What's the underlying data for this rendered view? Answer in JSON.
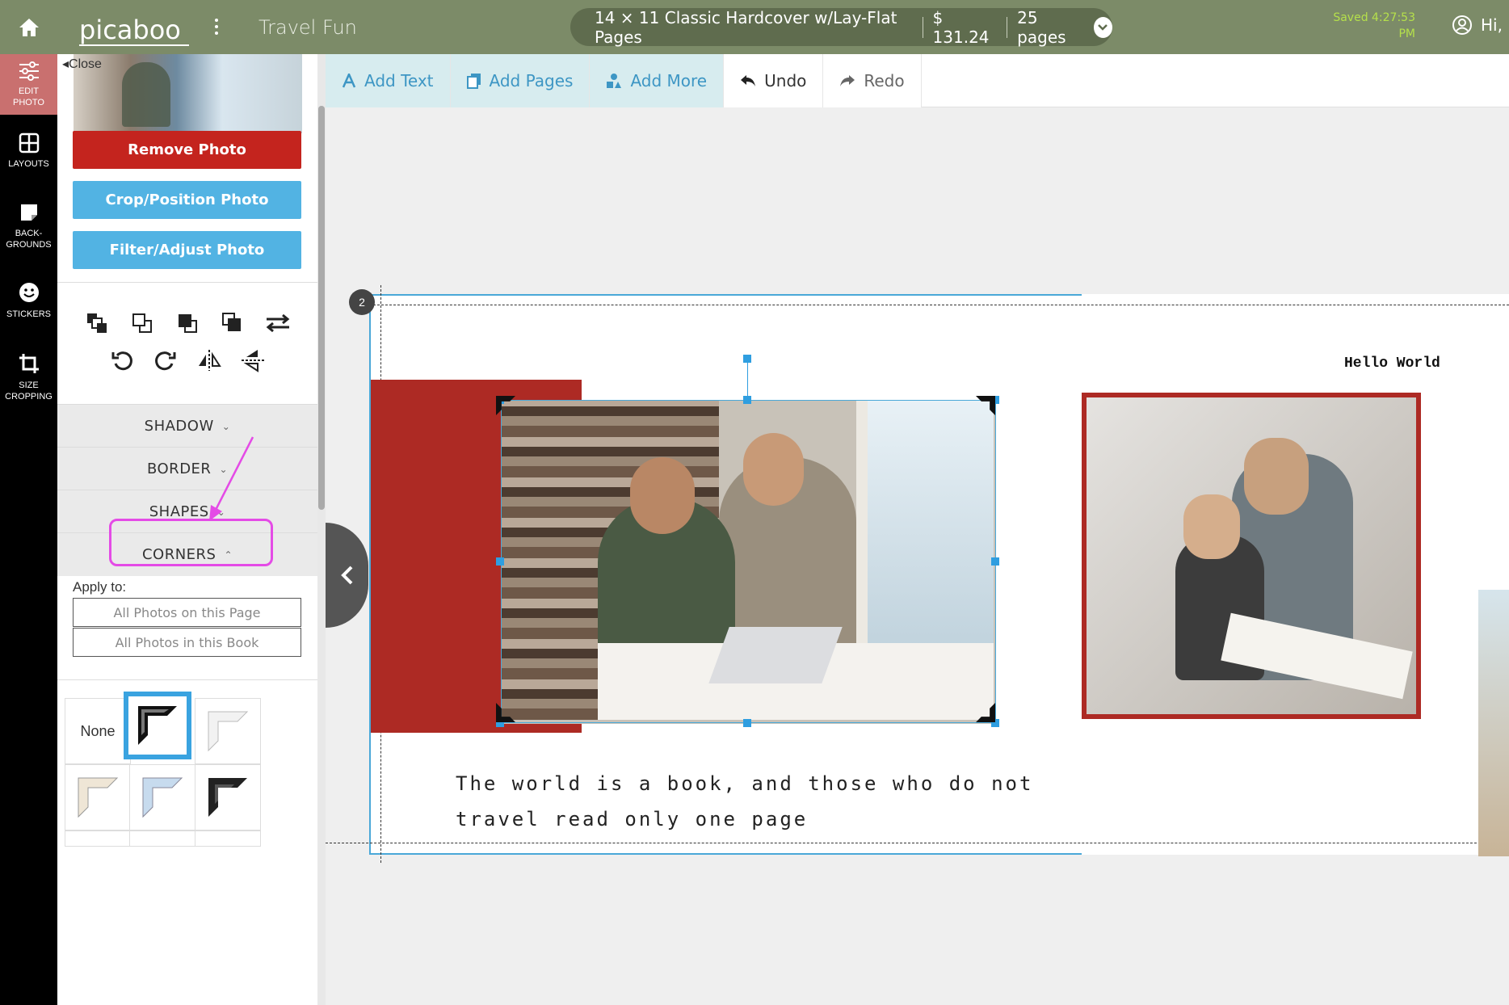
{
  "topbar": {
    "logo_text": "picaboo",
    "project_title": "Travel Fun",
    "product": "14 × 11 Classic Hardcover w/Lay-Flat Pages",
    "price": "$ 131.24",
    "pages": "25 pages",
    "saved_line1": "Saved 4:27:53",
    "saved_line2": "PM",
    "user_greeting": "Hi, I"
  },
  "leftnav": {
    "items": [
      {
        "label1": "EDIT",
        "label2": "PHOTO",
        "icon": "sliders-icon"
      },
      {
        "label1": "LAYOUTS",
        "label2": "",
        "icon": "grid-icon"
      },
      {
        "label1": "BACK-",
        "label2": "GROUNDS",
        "icon": "note-icon"
      },
      {
        "label1": "STICKERS",
        "label2": "",
        "icon": "smiley-icon"
      },
      {
        "label1": "SIZE",
        "label2": "CROPPING",
        "icon": "crop-icon"
      }
    ]
  },
  "panel": {
    "close_label": "Close",
    "remove_photo": "Remove Photo",
    "crop_position": "Crop/Position Photo",
    "filter_adjust": "Filter/Adjust Photo",
    "accordion": {
      "shadow": "SHADOW",
      "border": "BORDER",
      "shapes": "SHAPES",
      "corners": "CORNERS"
    },
    "apply_to": "Apply to:",
    "apply_page": "All Photos on this Page",
    "apply_book": "All Photos in this Book",
    "corner_none": "None"
  },
  "toolbar": {
    "add_text": "Add Text",
    "add_pages": "Add Pages",
    "add_more": "Add More",
    "undo": "Undo",
    "redo": "Redo"
  },
  "canvas": {
    "page_number": "2",
    "quote": "The world is a book, and those who do not travel read only one page",
    "hello": "Hello World"
  },
  "colors": {
    "topbar": "#7c8b68",
    "accent_red": "#ad2a24",
    "accent_blue": "#52b3e3",
    "highlight_pink": "#e44be6"
  }
}
